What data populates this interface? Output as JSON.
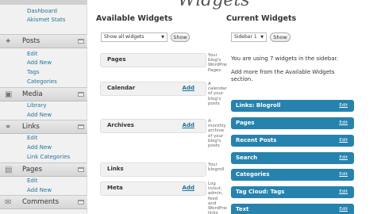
{
  "page": {
    "title": "Widgets"
  },
  "sidebar": {
    "top_items": [
      "Dashboard",
      "Akismet Stats"
    ],
    "sections": [
      {
        "label": "Posts",
        "icon": "pin-icon",
        "items": [
          "Edit",
          "Add New",
          "Tags",
          "Categories"
        ]
      },
      {
        "label": "Media",
        "icon": "media-icon",
        "items": [
          "Library",
          "Add New"
        ]
      },
      {
        "label": "Links",
        "icon": "links-icon",
        "items": [
          "Edit",
          "Add New",
          "Link Categories"
        ]
      },
      {
        "label": "Pages",
        "icon": "pages-icon",
        "items": [
          "Edit",
          "Add New"
        ]
      },
      {
        "label": "Comments",
        "icon": "comments-icon",
        "items": []
      }
    ]
  },
  "available": {
    "title": "Available Widgets",
    "filter_value": "Show all widgets",
    "show_label": "Show",
    "widgets": [
      {
        "name": "Pages",
        "add": "",
        "desc": "Your blog's WordPress Pages"
      },
      {
        "name": "Calendar",
        "add": "Add",
        "desc": "A calendar of your blog's posts"
      },
      {
        "name": "Archives",
        "add": "Add",
        "desc": "A monthly archive of your blog's posts"
      },
      {
        "name": "Links",
        "add": "",
        "desc": "Your blogroll"
      },
      {
        "name": "Meta",
        "add": "Add",
        "desc": "Log in/out, admin, feed and WordPress links"
      }
    ]
  },
  "current": {
    "title": "Current Widgets",
    "sidebar_value": "Sidebar 1",
    "show_label": "Show",
    "info": "You are using 7 widgets in the sidebar.",
    "info2": "Add more from the Available Widgets section.",
    "edit_label": "Edit",
    "widgets": [
      "Links: Blogroll",
      "Pages",
      "Recent Posts",
      "Search",
      "Categories",
      "Tag Cloud: Tags",
      "Text"
    ]
  }
}
